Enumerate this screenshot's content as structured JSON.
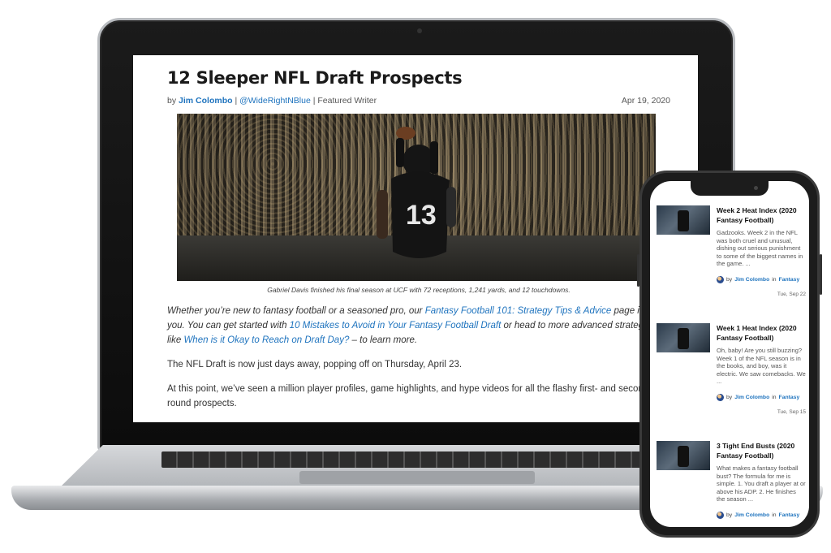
{
  "article": {
    "title": "12 Sleeper NFL Draft Prospects",
    "byline_prefix": "by",
    "author": "Jim Colombo",
    "separator": "|",
    "handle": "@WideRightNBlue",
    "role": "Featured Writer",
    "date": "Apr 19, 2020",
    "jersey_number": "13",
    "image_caption": "Gabriel Davis finished his final season at UCF with 72 receptions, 1,241 yards, and 12 touchdowns.",
    "intro": {
      "t1": "Whether you’re new to fantasy football or a seasoned pro, our ",
      "link1": "Fantasy Football 101: Strategy Tips & Advice",
      "t2": " page is f",
      "t3": "you. You can get started with ",
      "link2": "10 Mistakes to Avoid in Your Fantasy Football Draft",
      "t4": " or head to more advanced strategy",
      "t5": "like ",
      "link3": "When is it Okay to Reach on Draft Day?",
      "t6": " – to learn more."
    },
    "paragraph2": "The NFL Draft is now just days away, popping off on Thursday, April 23.",
    "paragraph3": "At this point, we’ve seen a million player profiles, game highlights, and hype videos for all the flashy first- and second",
    "paragraph3_cont": "round prospects."
  },
  "phone_feed": [
    {
      "title": "Week 2 Heat Index (2020 Fantasy Football)",
      "excerpt": "Gadzooks. Week 2 in the NFL was both cruel and unusual, dishing out serious punishment to some of the biggest names in the game. ...",
      "by": "by",
      "author": "Jim Colombo",
      "in": "in",
      "category": "Fantasy",
      "date": "Tue, Sep 22"
    },
    {
      "title": "Week 1 Heat Index (2020 Fantasy Football)",
      "excerpt": "Oh, baby! Are you still buzzing? Week 1 of the NFL season is in the books, and boy, was it electric. We saw comebacks. We ...",
      "by": "by",
      "author": "Jim Colombo",
      "in": "in",
      "category": "Fantasy",
      "date": "Tue, Sep 15"
    },
    {
      "title": "3 Tight End Busts (2020 Fantasy Football)",
      "excerpt": "What makes a fantasy football bust? The formula for me is simple. 1. You draft a player at or above his ADP. 2. He finishes the season ...",
      "by": "by",
      "author": "Jim Colombo",
      "in": "in",
      "category": "Fantasy",
      "date": ""
    }
  ],
  "colors": {
    "link": "#1e73be",
    "title": "#1a1a1a",
    "device_frame": "#1c1c1c"
  }
}
